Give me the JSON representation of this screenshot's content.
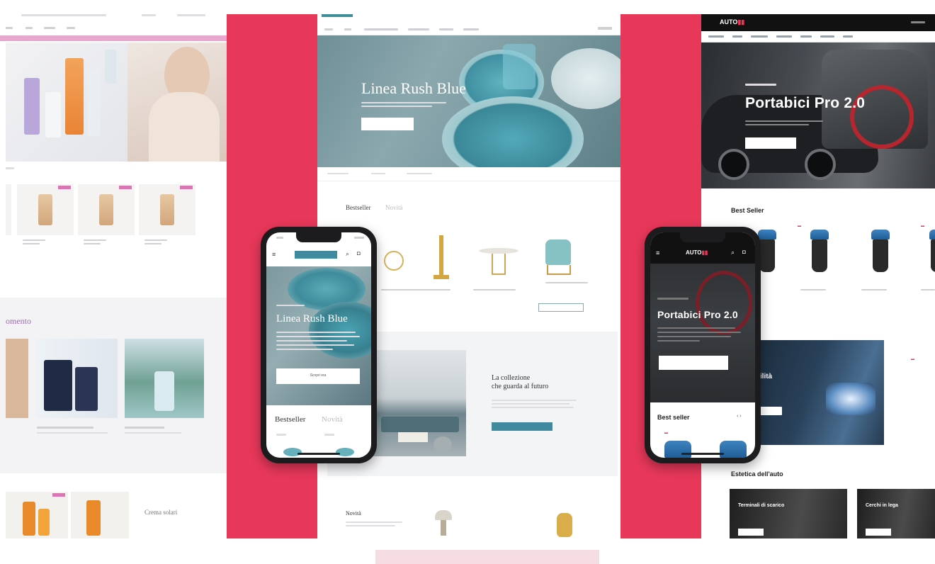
{
  "colors": {
    "accent_band": "#e8385a",
    "cosmetics_pink": "#e7a7cf",
    "homeware_teal": "#3f8a9e",
    "auto_black": "#111111"
  },
  "cosmetics": {
    "section_title": "omento",
    "column_label": "Crema solari"
  },
  "homeware": {
    "hero_title": "Linea Rush Blue",
    "tabs": {
      "best": "Bestseller",
      "new": "Novità"
    },
    "collection_title_line1": "La collezione",
    "collection_title_line2": "che guarda al futuro",
    "novita_section": "Novità"
  },
  "automotive": {
    "logo_main": "AUTO",
    "hero_title": "Portabici Pro 2.0",
    "best_seller_title": "Best Seller",
    "estetica_title": "Estetica dell'auto",
    "card_a": "Terminali di scarico",
    "card_b": "Cerchi in lega",
    "band_text": "ibilità"
  },
  "phone_home": {
    "hero_title": "Linea Rush Blue",
    "cta": "Scopri ora",
    "tab_best": "Bestseller",
    "tab_new": "Novità"
  },
  "phone_auto": {
    "logo": "AUTO",
    "hero_title": "Portabici Pro 2.0",
    "best_seller": "Best seller"
  }
}
